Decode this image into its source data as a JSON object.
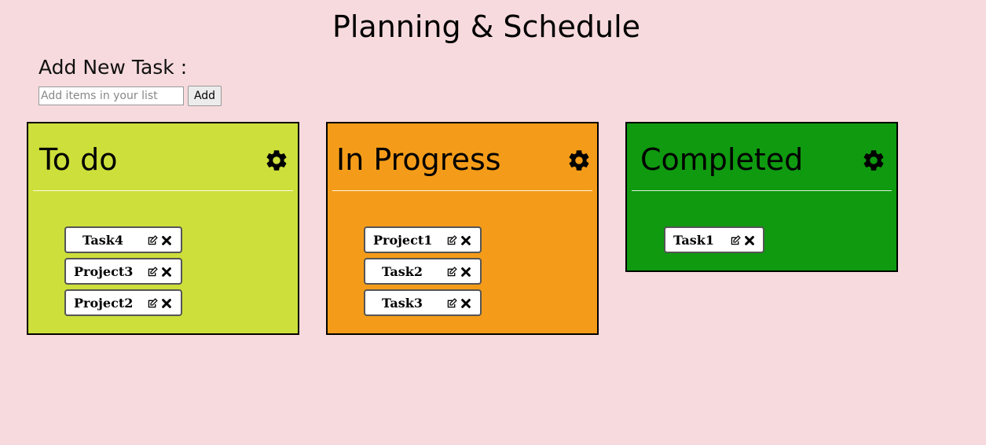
{
  "page": {
    "title": "Planning & Schedule"
  },
  "add_task": {
    "heading": "Add New Task :",
    "input_placeholder": "Add items in your list",
    "input_value": "",
    "button_label": "Add"
  },
  "columns": [
    {
      "title": "To do",
      "color": "#cddf3a",
      "tasks": [
        "Task4",
        "Project3",
        "Project2"
      ]
    },
    {
      "title": "In Progress",
      "color": "#f49c19",
      "tasks": [
        "Project1",
        "Task2",
        "Task3"
      ]
    },
    {
      "title": "Completed",
      "color": "#0f9a10",
      "tasks": [
        "Task1"
      ]
    }
  ],
  "icons": {
    "settings": "gear-icon",
    "edit": "edit-icon",
    "delete": "close-icon"
  }
}
